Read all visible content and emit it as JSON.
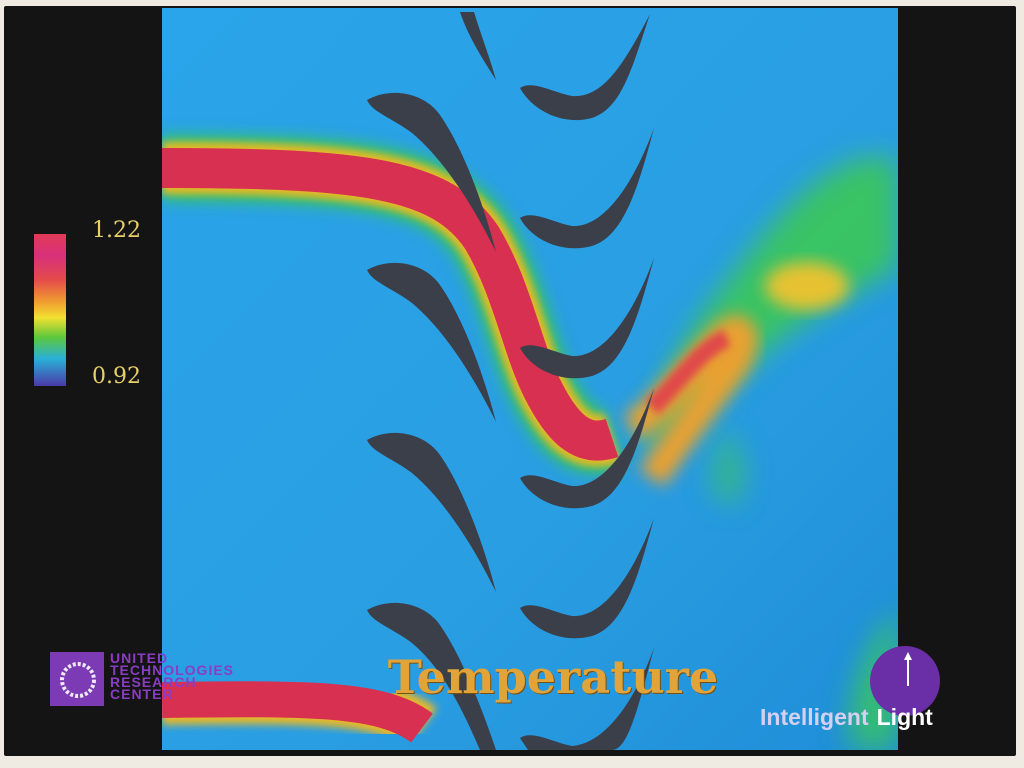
{
  "scale": {
    "max_label": "1.22",
    "min_label": "0.92",
    "colors": [
      "#e23a56",
      "#d8307a",
      "#e44a4a",
      "#f0a030",
      "#f2e030",
      "#5cc83c",
      "#2ab0d8",
      "#4a3aa8"
    ]
  },
  "title": "Temperature",
  "logo_left": {
    "lines": [
      "UNITED",
      "TECHNOLOGIES",
      "RESEARCH",
      "CENTER"
    ],
    "icon": "swirl-logo-icon",
    "color": "#7c3ab4"
  },
  "logo_right": {
    "word1": "Intelligent",
    "word2": "Light",
    "icon": "globe-logo-icon",
    "color": "#6a2ea6"
  },
  "colors": {
    "background_field": "#2aa0e6",
    "blade": "#3a3f4a",
    "hot_streak": "#d8304e"
  }
}
